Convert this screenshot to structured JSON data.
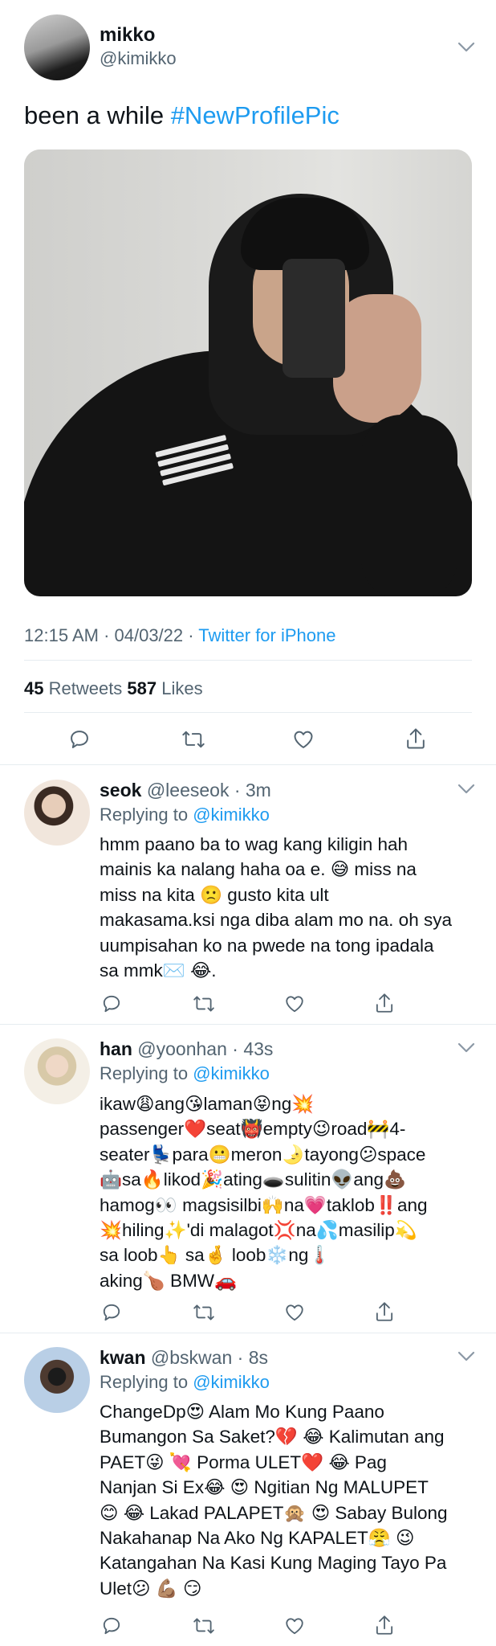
{
  "tweet": {
    "author_name": "mikko",
    "author_handle": "@kimikko",
    "text_plain": "been a while ",
    "hashtag": "#NewProfilePic",
    "time": "12:15 AM · 04/03/22 · ",
    "source": "Twitter for iPhone",
    "retweets_count": "45",
    "retweets_label": " Retweets ",
    "likes_count": "587",
    "likes_label": " Likes"
  },
  "replies": [
    {
      "name": "seok",
      "handle": " @leeseok · 3m",
      "replying_prefix": "Replying to ",
      "replying_user": "@kimikko",
      "text": "hmm paano ba to wag kang kiligin hah\nmainis ka nalang haha oa e. 😅 miss na\nmiss na kita 🙁 gusto kita ult\nmakasama.ksi nga diba alam mo na. oh sya\nuumpisahan ko na pwede na tong ipadala\nsa mmk✉️ 😂."
    },
    {
      "name": "han",
      "handle": " @yoonhan · 43s",
      "replying_prefix": "Replying to ",
      "replying_user": "@kimikko",
      "text": "ikaw😩ang😘laman😝ng💥\npassenger❤️seat👹empty😉road🚧4-\nseater💺para😬meron🌛tayong😕space\n🤖sa🔥likod🎉ating🕳️sulitin👽ang💩\nhamog👀 magsisilbi🙌na💗taklob‼️ang\n💥hiling✨'di malagot💢na💦masilip💫\nsa loob👆 sa🤞 loob❄️ng🌡️\naking🍗 BMW🚗"
    },
    {
      "name": "kwan",
      "handle": " @bskwan · 8s",
      "replying_prefix": "Replying to ",
      "replying_user": "@kimikko",
      "text": "ChangeDp😍 Alam Mo Kung  Paano\nBumangon Sa Saket?💔 😂 Kalimutan ang\nPAET😜 💘 Porma ULET❤️ 😂 Pag\nNanjan Si Ex😂 😍 Ngitian Ng MALUPET\n😊 😂 Lakad PALAPET🙊 😍 Sabay Bulong\nNakahanap Na Ako Ng KAPALET😤 😉\nKatangahan Na Kasi Kung Maging Tayo Pa\nUlet😕 💪🏽 😏"
    }
  ],
  "icons": {
    "reply": "comment-icon",
    "retweet": "retweet-icon",
    "like": "heart-icon",
    "share": "share-icon",
    "more": "chevron-down-icon"
  },
  "colors": {
    "accent": "#1d9bf0",
    "secondary_text": "#536471",
    "icon": "#536471",
    "divider": "#e6ecf0"
  }
}
